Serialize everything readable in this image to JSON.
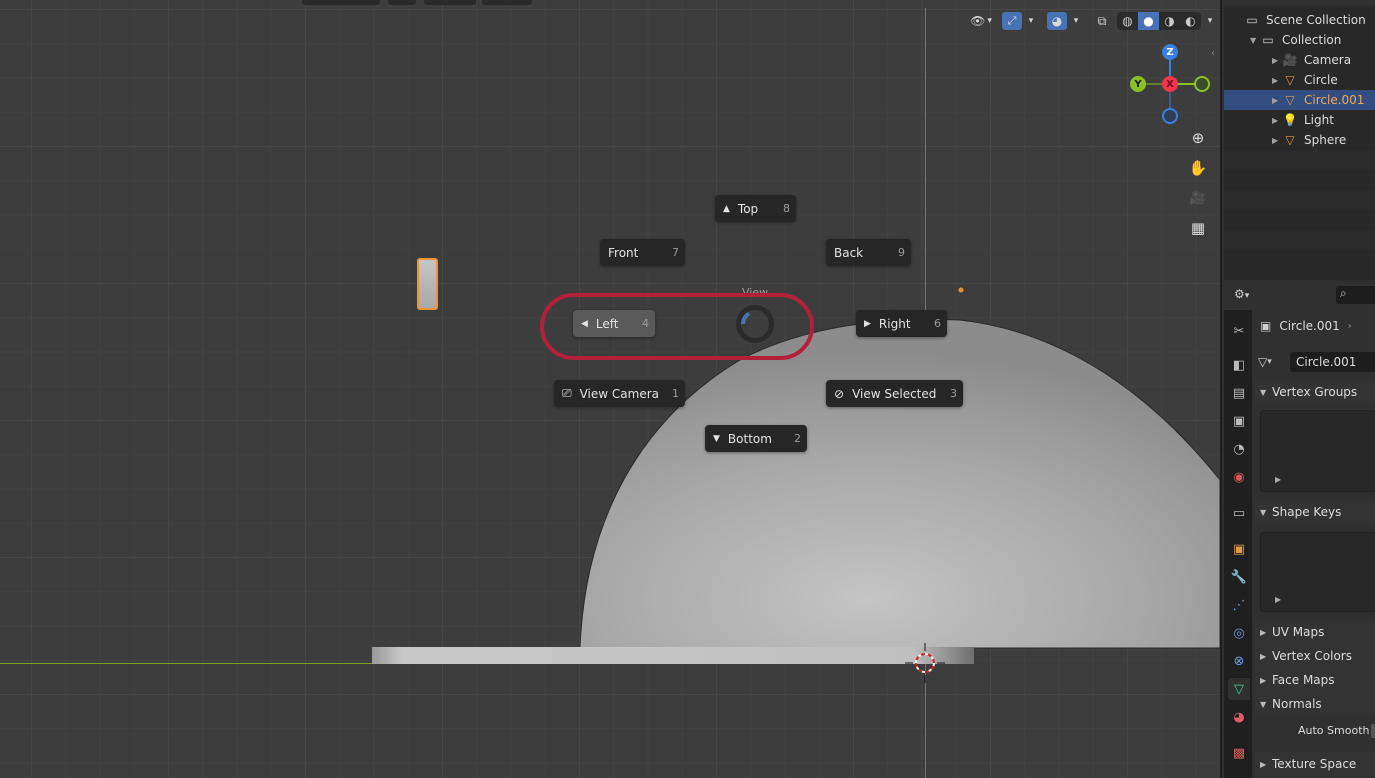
{
  "viewport": {
    "pie_menu": {
      "title": "View",
      "items": {
        "top": {
          "label": "Top",
          "key": "8"
        },
        "front": {
          "label": "Front",
          "key": "7"
        },
        "back": {
          "label": "Back",
          "key": "9"
        },
        "left": {
          "label": "Left",
          "key": "4"
        },
        "right": {
          "label": "Right",
          "key": "6"
        },
        "view_camera": {
          "label": "View Camera",
          "key": "1"
        },
        "view_selected": {
          "label": "View Selected",
          "key": "3"
        },
        "bottom": {
          "label": "Bottom",
          "key": "2"
        }
      }
    },
    "gizmo": {
      "z": "Z",
      "y": "Y",
      "x": "X"
    },
    "colors": {
      "x_axis": "#f0354d",
      "y_axis": "#8ac226",
      "z_axis": "#3a7ee0",
      "highlight_ring": "#b3203b"
    }
  },
  "outliner": {
    "root": "Scene Collection",
    "collection": "Collection",
    "items": [
      {
        "label": "Camera",
        "icon": "camera-icon",
        "color": "#e09b4a"
      },
      {
        "label": "Circle",
        "icon": "mesh-icon",
        "color": "#e09b4a"
      },
      {
        "label": "Circle.001",
        "icon": "mesh-icon",
        "color": "#e09b4a"
      },
      {
        "label": "Light",
        "icon": "light-icon",
        "color": "#e09b4a"
      },
      {
        "label": "Sphere",
        "icon": "mesh-icon",
        "color": "#e09b4a"
      }
    ]
  },
  "properties": {
    "object_name": "Circle.001",
    "mesh_name": "Circle.001",
    "panels": {
      "vertex_groups": "Vertex Groups",
      "shape_keys": "Shape Keys",
      "uv_maps": "UV Maps",
      "vertex_colors": "Vertex Colors",
      "face_maps": "Face Maps",
      "normals": "Normals",
      "auto_smooth": "Auto Smooth",
      "texture_space": "Texture Space"
    }
  }
}
